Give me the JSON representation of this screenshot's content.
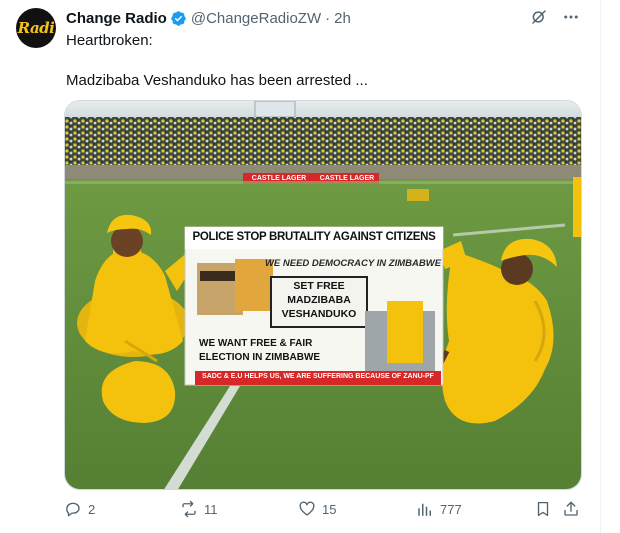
{
  "author": {
    "avatar_text": "Radi",
    "display_name": "Change Radio",
    "handle": "@ChangeRadioZW",
    "separator": "·",
    "time": "2h"
  },
  "tweet": {
    "lines": [
      "Heartbroken:",
      "Madzibaba Veshanduko has been arrested ..."
    ]
  },
  "media": {
    "billboard_left": "CASTLE LAGER",
    "billboard_right": "CASTLE LAGER",
    "banner": {
      "headline": "POLICE STOP BRUTALITY AGAINST CITIZENS",
      "sub": "WE NEED DEMOCRACY IN ZIMBABWE",
      "box_line1": "SET FREE",
      "box_line2": "MADZIBABA",
      "box_line3": "VESHANDUKO",
      "bottom_line1": "WE WANT FREE & FAIR",
      "bottom_line2": "ELECTION IN ZIMBABWE",
      "footer": "SADC & E.U HELPS US, WE ARE SUFFERING BECAUSE OF ZANU-PF"
    }
  },
  "actions": {
    "replies": "2",
    "reposts": "11",
    "likes": "15",
    "views": "777"
  },
  "colors": {
    "accent": "#1d9bf0",
    "muted": "#536471",
    "grass": "#5f8a3d",
    "dress": "#f4c20d"
  }
}
